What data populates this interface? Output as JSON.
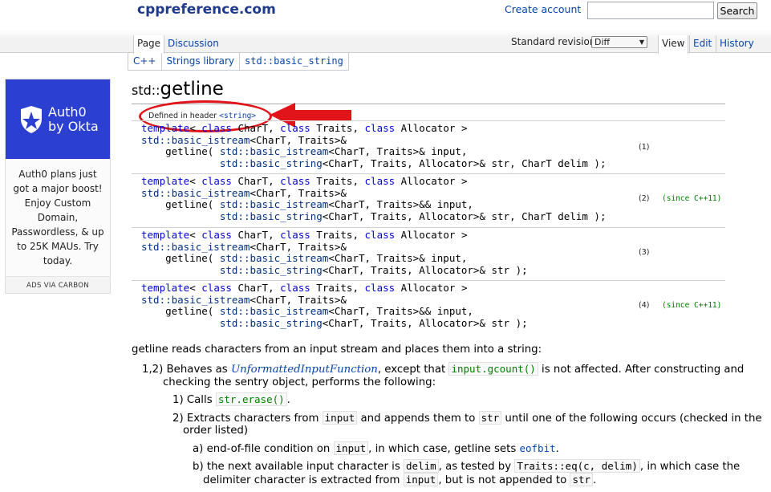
{
  "header": {
    "logo": "cppreference.com",
    "create_account": "Create account",
    "search_placeholder": "",
    "search_button": "Search"
  },
  "tabs": {
    "page": "Page",
    "discussion": "Discussion",
    "standard_revision_label": "Standard revision:",
    "standard_revision_value": "Diff",
    "view": "View",
    "edit": "Edit",
    "history": "History"
  },
  "breadcrumb": [
    "C++",
    "Strings library",
    "std::basic_string"
  ],
  "ad": {
    "brand_line1": "Auth0",
    "brand_line2": "by Okta",
    "text": "Auth0 plans just got a major boost! Enjoy Custom Domain, Passwordless, & up to 25K MAUs. Try today.",
    "footer": "ADS VIA CARBON",
    "banner_color": "#2b3fd0"
  },
  "title": {
    "namespace": "std::",
    "name": "getline"
  },
  "defined_in": {
    "label": "Defined in header",
    "header": "<string>"
  },
  "declarations": [
    {
      "l1": [
        "template",
        "< ",
        "class",
        " CharT, ",
        "class",
        " Traits, ",
        "class",
        " Allocator >"
      ],
      "l2": [
        "std::basic_istream",
        "<CharT, Traits>&"
      ],
      "l3": [
        "    getline( ",
        "std::basic_istream",
        "<CharT, Traits>& input,"
      ],
      "l4": [
        "             ",
        "std::basic_string",
        "<CharT, Traits, Allocator>& str, CharT delim );"
      ],
      "number": "(1)",
      "since": ""
    },
    {
      "l1": [
        "template",
        "< ",
        "class",
        " CharT, ",
        "class",
        " Traits, ",
        "class",
        " Allocator >"
      ],
      "l2": [
        "std::basic_istream",
        "<CharT, Traits>&"
      ],
      "l3": [
        "    getline( ",
        "std::basic_istream",
        "<CharT, Traits>&& input,"
      ],
      "l4": [
        "             ",
        "std::basic_string",
        "<CharT, Traits, Allocator>& str, CharT delim );"
      ],
      "number": "(2)",
      "since": "(since C++11)"
    },
    {
      "l1": [
        "template",
        "< ",
        "class",
        " CharT, ",
        "class",
        " Traits, ",
        "class",
        " Allocator >"
      ],
      "l2": [
        "std::basic_istream",
        "<CharT, Traits>&"
      ],
      "l3": [
        "    getline( ",
        "std::basic_istream",
        "<CharT, Traits>& input,"
      ],
      "l4": [
        "             ",
        "std::basic_string",
        "<CharT, Traits, Allocator>& str );"
      ],
      "number": "(3)",
      "since": ""
    },
    {
      "l1": [
        "template",
        "< ",
        "class",
        " CharT, ",
        "class",
        " Traits, ",
        "class",
        " Allocator >"
      ],
      "l2": [
        "std::basic_istream",
        "<CharT, Traits>&"
      ],
      "l3": [
        "    getline( ",
        "std::basic_istream",
        "<CharT, Traits>&& input,"
      ],
      "l4": [
        "             ",
        "std::basic_string",
        "<CharT, Traits, Allocator>& str );"
      ],
      "number": "(4)",
      "since": "(since C++11)"
    }
  ],
  "description": {
    "intro": "getline reads characters from an input stream and places them into a string:",
    "p1": {
      "prefix": "1,2) Behaves as ",
      "link": "UnformattedInputFunction",
      "mid": ", except that ",
      "code": "input.gcount()",
      "rest1": " is not affected. After constructing and",
      "line2": "checking the sentry object, performs the following:"
    },
    "s1": {
      "prefix": "1) Calls ",
      "code": "str.erase()",
      "suffix": "."
    },
    "s2": {
      "prefix": "2) Extracts characters from ",
      "code1": "input",
      "mid": " and appends them to ",
      "code2": "str",
      "rest1": " until one of the following occurs (checked in the",
      "line2": "order listed)"
    },
    "sa": {
      "prefix": "a) end-of-file condition on ",
      "code": "input",
      "mid": ", in which case, getline sets ",
      "link": "eofbit",
      "suffix": "."
    },
    "sb": {
      "prefix": "b) the next available input character is ",
      "code1": "delim",
      "mid": ", as tested by ",
      "code2": "Traits::eq(c, delim)",
      "rest1": ", in which case the",
      "l2_prefix": "delimiter character is extracted from ",
      "l2_code1": "input",
      "l2_mid": ", but is not appended to ",
      "l2_code2": "str",
      "l2_suffix": "."
    }
  }
}
